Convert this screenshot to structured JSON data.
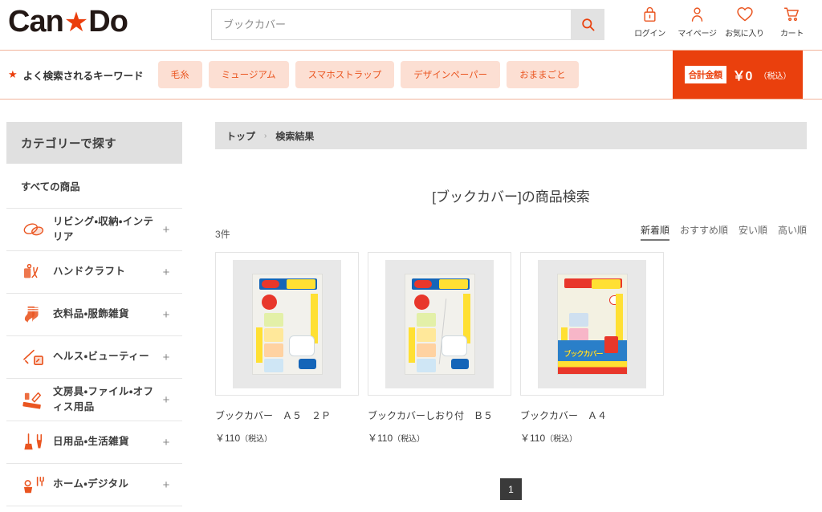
{
  "brand": {
    "name_left": "Can",
    "star": "★",
    "name_right": "Do",
    "accent_color": "#ea400d",
    "chip_bg_color": "#fcdfd3"
  },
  "search": {
    "value": "ブックカバー",
    "placeholder": "ブックカバー",
    "button_icon": "search-icon"
  },
  "header_links": [
    {
      "icon": "lock-icon",
      "label": "ログイン"
    },
    {
      "icon": "user-icon",
      "label": "マイページ"
    },
    {
      "icon": "heart-icon",
      "label": "お気に入り"
    },
    {
      "icon": "cart-icon",
      "label": "カート"
    }
  ],
  "keyword_bar": {
    "star": "★",
    "title": "よく検索されるキーワード",
    "chips": [
      "毛糸",
      "ミュージアム",
      "スマホストラップ",
      "デザインペーパー",
      "おままごと"
    ],
    "total": {
      "badge": "合計金額",
      "amount": "￥0",
      "tax_note": "（税込）"
    }
  },
  "sidebar": {
    "heading": "カテゴリーで探す",
    "all_label": "すべての商品",
    "expand_symbol": "+",
    "items": [
      {
        "icon": "cushion-icon",
        "label": "リビング・収納・インテリア"
      },
      {
        "icon": "craft-icon",
        "label": "ハンドクラフト"
      },
      {
        "icon": "socks-icon",
        "label": "衣料品・服飾雑貨"
      },
      {
        "icon": "beauty-icon",
        "label": "ヘルス・ビューティー"
      },
      {
        "icon": "stationery-icon",
        "label": "文房具・ファイル・オフィス用品"
      },
      {
        "icon": "cleaning-icon",
        "label": "日用品・生活雑貨"
      },
      {
        "icon": "home-icon",
        "label": "ホーム・デジタル"
      }
    ]
  },
  "breadcrumb": {
    "items": [
      "トップ",
      "検索結果"
    ],
    "separator": "›"
  },
  "results": {
    "title": "[ブックカバー]の商品検索",
    "count": "3件",
    "sorts": [
      {
        "label": "新着順",
        "active": true
      },
      {
        "label": "おすすめ順",
        "active": false
      },
      {
        "label": "安い順",
        "active": false
      },
      {
        "label": "高い順",
        "active": false
      }
    ],
    "products": [
      {
        "title": "ブックカバー　Ａ５　２Ｐ",
        "price": "￥110",
        "tax": "（税込）",
        "image": "book-cover-a5-2p-package"
      },
      {
        "title": "ブックカバーしおり付　Ｂ５",
        "price": "￥110",
        "tax": "（税込）",
        "image": "book-cover-bookmark-b5-package"
      },
      {
        "title": "ブックカバー　Ａ４",
        "price": "￥110",
        "tax": "（税込）",
        "image": "book-cover-a4-package"
      }
    ],
    "pagination": {
      "current": "1"
    }
  }
}
